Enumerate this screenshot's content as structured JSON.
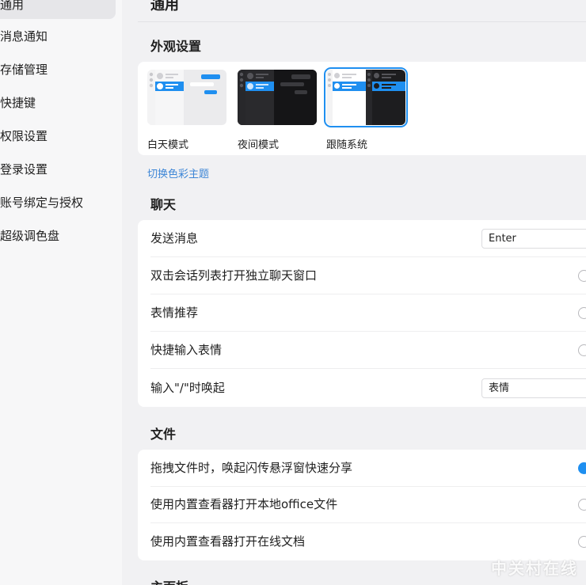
{
  "sidebar": {
    "items": [
      {
        "label": "通用",
        "active": true
      },
      {
        "label": "消息通知"
      },
      {
        "label": "存储管理"
      },
      {
        "label": "快捷键"
      },
      {
        "label": "权限设置"
      },
      {
        "label": "登录设置"
      },
      {
        "label": "账号绑定与授权"
      },
      {
        "label": "超级调色盘"
      }
    ]
  },
  "main": {
    "title": "通用",
    "appearance": {
      "title": "外观设置",
      "themes": [
        {
          "label": "白天模式"
        },
        {
          "label": "夜间模式"
        },
        {
          "label": "跟随系统",
          "selected": true
        }
      ],
      "switch_theme_link": "切换色彩主题"
    },
    "chat": {
      "title": "聊天",
      "rows": [
        {
          "label": "发送消息",
          "control": "select",
          "value": "Enter"
        },
        {
          "label": "双击会话列表打开独立聊天窗口",
          "control": "radio",
          "checked": false
        },
        {
          "label": "表情推荐",
          "control": "radio",
          "checked": false
        },
        {
          "label": "快捷输入表情",
          "control": "radio",
          "checked": false
        },
        {
          "label": "输入\"/\"时唤起",
          "control": "select",
          "value": "表情"
        }
      ]
    },
    "files": {
      "title": "文件",
      "rows": [
        {
          "label": "拖拽文件时，唤起闪传悬浮窗快速分享",
          "checked": true
        },
        {
          "label": "使用内置查看器打开本地office文件",
          "checked": false
        },
        {
          "label": "使用内置查看器打开在线文档",
          "checked": false
        }
      ]
    },
    "next_section_title": "主面板"
  },
  "watermark": "中关村在线",
  "colors": {
    "accent": "#1f8ff0",
    "link": "#3d86d6"
  }
}
